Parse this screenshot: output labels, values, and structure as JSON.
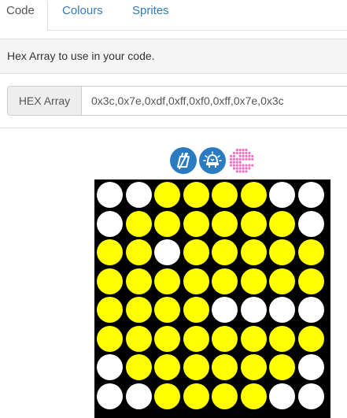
{
  "tabs": [
    {
      "label": "Code",
      "active": true
    },
    {
      "label": "Colours",
      "active": false
    },
    {
      "label": "Sprites",
      "active": false
    }
  ],
  "info": {
    "text": "Hex Array to use in your code."
  },
  "hex_array": {
    "label": "HEX Array",
    "value": "0x3c,0x7e,0xdf,0xff,0xf0,0xff,0x7e,0x3c"
  },
  "tools": [
    {
      "name": "clear-icon"
    },
    {
      "name": "invert-icon"
    },
    {
      "name": "pacman-sprite-icon"
    }
  ],
  "colors": {
    "on": "#ffff00",
    "off": "#ffffff",
    "background": "#000000",
    "accent": "#2a7bc0",
    "sprite": "#f56fc0"
  },
  "matrix": {
    "rows": [
      [
        0,
        0,
        1,
        1,
        1,
        1,
        0,
        0
      ],
      [
        0,
        1,
        1,
        1,
        1,
        1,
        1,
        0
      ],
      [
        1,
        1,
        0,
        1,
        1,
        1,
        1,
        1
      ],
      [
        1,
        1,
        1,
        1,
        1,
        1,
        1,
        1
      ],
      [
        1,
        1,
        1,
        1,
        0,
        0,
        0,
        0
      ],
      [
        1,
        1,
        1,
        1,
        1,
        1,
        1,
        1
      ],
      [
        0,
        1,
        1,
        1,
        1,
        1,
        1,
        0
      ],
      [
        0,
        0,
        1,
        1,
        1,
        1,
        0,
        0
      ]
    ]
  }
}
